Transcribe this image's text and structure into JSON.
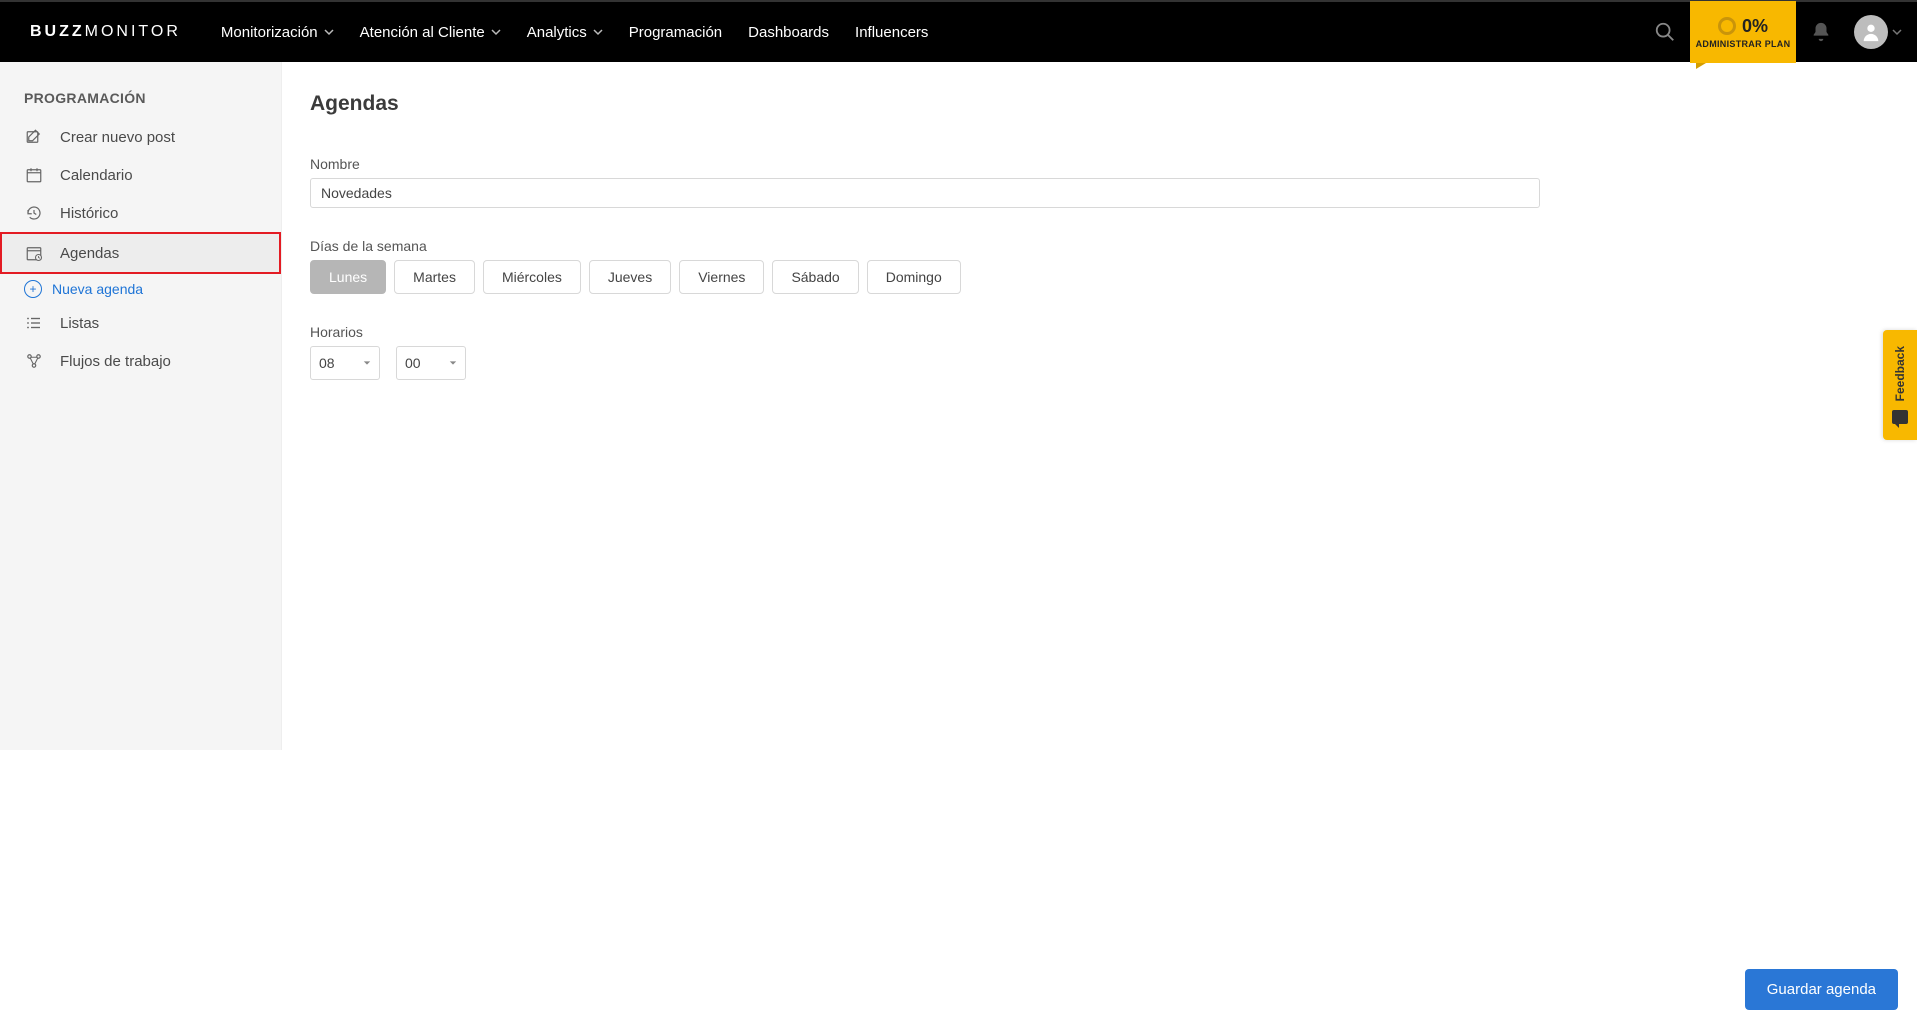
{
  "brand": {
    "strong": "BUZZ",
    "rest": "MONITOR"
  },
  "topnav": {
    "items": [
      {
        "label": "Monitorización",
        "caret": true
      },
      {
        "label": "Atención al Cliente",
        "caret": true
      },
      {
        "label": "Analytics",
        "caret": true
      },
      {
        "label": "Programación",
        "caret": false
      },
      {
        "label": "Dashboards",
        "caret": false
      },
      {
        "label": "Influencers",
        "caret": false
      }
    ]
  },
  "plan": {
    "percent": "0%",
    "label": "ADMINISTRAR PLAN"
  },
  "sidebar": {
    "title": "PROGRAMACIÓN",
    "items": {
      "new_post": "Crear nuevo post",
      "calendar": "Calendario",
      "history": "Histórico",
      "agendas": "Agendas",
      "new_agenda": "Nueva agenda",
      "lists": "Listas",
      "workflows": "Flujos de trabajo"
    }
  },
  "main": {
    "title": "Agendas",
    "name_label": "Nombre",
    "name_value": "Novedades",
    "days_label": "Días de la semana",
    "days": [
      {
        "label": "Lunes",
        "active": true
      },
      {
        "label": "Martes",
        "active": false
      },
      {
        "label": "Miércoles",
        "active": false
      },
      {
        "label": "Jueves",
        "active": false
      },
      {
        "label": "Viernes",
        "active": false
      },
      {
        "label": "Sábado",
        "active": false
      },
      {
        "label": "Domingo",
        "active": false
      }
    ],
    "hours_label": "Horarios",
    "hour_value": "08",
    "minute_value": "00",
    "save_label": "Guardar agenda"
  },
  "feedback": {
    "label": "Feedback"
  }
}
